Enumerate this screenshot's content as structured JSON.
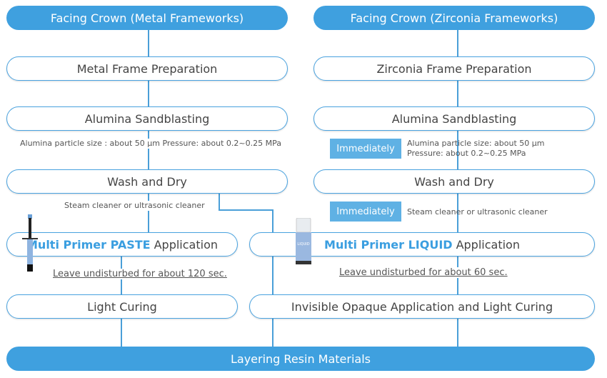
{
  "left": {
    "header": "Facing Crown (Metal Frameworks)",
    "step1": "Metal Frame Preparation",
    "step2": "Alumina Sandblasting",
    "note2": "Alumina particle size : about 50 μm Pressure: about 0.2~0.25 MPa",
    "step3": "Wash and Dry",
    "note3": "Steam cleaner or ultrasonic cleaner",
    "step4_bold": "Multi Primer PASTE",
    "step4_rest": "Application",
    "note4": "Leave undisturbed for about 120 sec.",
    "step5": "Light Curing",
    "product_icon": "syringe-icon"
  },
  "right": {
    "header": "Facing Crown (Zirconia Frameworks)",
    "step1": "Zirconia Frame Preparation",
    "step2": "Alumina Sandblasting",
    "badge": "Immediately",
    "note2a": "Alumina particle size: about 50 μm",
    "note2b": "Pressure: about 0.2~0.25 MPa",
    "step3": "Wash and Dry",
    "note3": "Steam cleaner or ultrasonic cleaner",
    "step4_bold": "Multi Primer LIQUID",
    "step4_rest": "Application",
    "note4": "Leave undisturbed for about 60 sec.",
    "step5": "Invisible Opaque Application and Light Curing",
    "product_icon": "bottle-icon",
    "bottle_label": "LIQUID"
  },
  "final": "Layering Resin Materials",
  "colors": {
    "accent": "#3fa0df",
    "badge": "#5fb1e4",
    "text": "#444444"
  }
}
